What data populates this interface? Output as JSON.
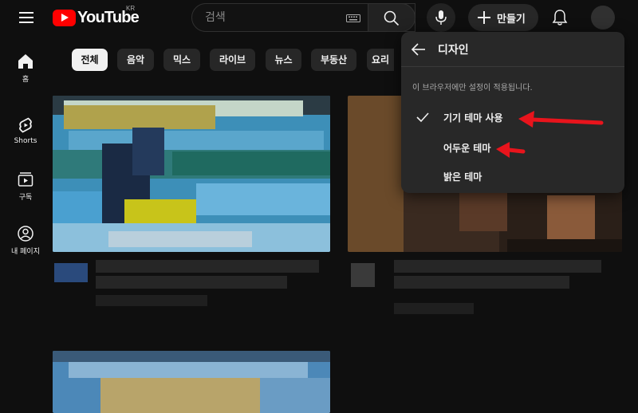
{
  "header": {
    "logo_text": "YouTube",
    "logo_region": "KR",
    "search_placeholder": "검색",
    "create_label": "만들기"
  },
  "nav": {
    "items": [
      {
        "label": "홈",
        "icon": "home-icon"
      },
      {
        "label": "Shorts",
        "icon": "shorts-icon"
      },
      {
        "label": "구독",
        "icon": "subscriptions-icon"
      },
      {
        "label": "내 페이지",
        "icon": "account-icon"
      }
    ]
  },
  "chips": [
    "전체",
    "음악",
    "믹스",
    "라이브",
    "뉴스",
    "부동산",
    "요리"
  ],
  "appearance_menu": {
    "title": "디자인",
    "note": "이 브라우저에만 설정이 적용됩니다.",
    "options": [
      {
        "label": "기기 테마 사용",
        "selected": true
      },
      {
        "label": "어두운 테마",
        "selected": false
      },
      {
        "label": "밝은 테마",
        "selected": false
      }
    ]
  },
  "colors": {
    "background": "#0f0f0f",
    "brand_red": "#ff0000",
    "annotation_arrow": "#e8141c",
    "popup": "#282828"
  }
}
